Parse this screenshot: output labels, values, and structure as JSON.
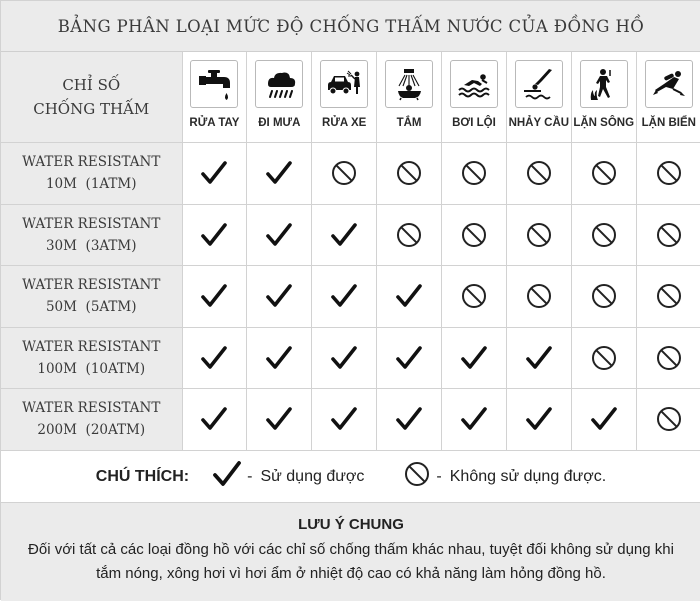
{
  "title": "BẢNG PHÂN LOẠI MỨC ĐỘ CHỐNG THẤM NƯỚC CỦA ĐỒNG HỒ",
  "header_label_line1": "CHỈ SỐ",
  "header_label_line2": "CHỐNG THẤM",
  "activities": [
    {
      "label": "RỬA TAY",
      "icon": "faucet-icon"
    },
    {
      "label": "ĐI MƯA",
      "icon": "rain-cloud-icon"
    },
    {
      "label": "RỬA XE",
      "icon": "car-wash-icon"
    },
    {
      "label": "TẮM",
      "icon": "shower-icon"
    },
    {
      "label": "BƠI LỘI",
      "icon": "swimmer-icon"
    },
    {
      "label": "NHẢY CẦU",
      "icon": "diver-icon"
    },
    {
      "label": "LẶN SÔNG",
      "icon": "snorkel-diver-icon"
    },
    {
      "label": "LẶN BIỂN",
      "icon": "scuba-diver-icon"
    }
  ],
  "rows": [
    {
      "line1": "WATER RESISTANT",
      "line2": "10M  (1ATM)",
      "cells": [
        "yes",
        "yes",
        "no",
        "no",
        "no",
        "no",
        "no",
        "no"
      ]
    },
    {
      "line1": "WATER RESISTANT",
      "line2": "30M  (3ATM)",
      "cells": [
        "yes",
        "yes",
        "yes",
        "no",
        "no",
        "no",
        "no",
        "no"
      ]
    },
    {
      "line1": "WATER RESISTANT",
      "line2": "50M  (5ATM)",
      "cells": [
        "yes",
        "yes",
        "yes",
        "yes",
        "no",
        "no",
        "no",
        "no"
      ]
    },
    {
      "line1": "WATER RESISTANT",
      "line2": "100M  (10ATM)",
      "cells": [
        "yes",
        "yes",
        "yes",
        "yes",
        "yes",
        "yes",
        "no",
        "no"
      ]
    },
    {
      "line1": "WATER RESISTANT",
      "line2": "200M  (20ATM)",
      "cells": [
        "yes",
        "yes",
        "yes",
        "yes",
        "yes",
        "yes",
        "yes",
        "no"
      ]
    }
  ],
  "legend": {
    "title": "CHÚ THÍCH:",
    "yes_label": "Sử dụng được",
    "no_label": "Không sử dụng được.",
    "dash": "-"
  },
  "note": {
    "title": "LƯU Ý CHUNG",
    "text": "Đối với tất cả các loại đồng hồ với các chỉ số chống thấm khác nhau, tuyệt đối không sử dụng khi tắm nóng, xông hơi vì hơi ẩm ở nhiệt độ cao có khả năng làm hỏng đồng hồ."
  },
  "colors": {
    "ink": "#222222",
    "header_bg": "#ebebeb",
    "grid": "#d2d2d2"
  }
}
